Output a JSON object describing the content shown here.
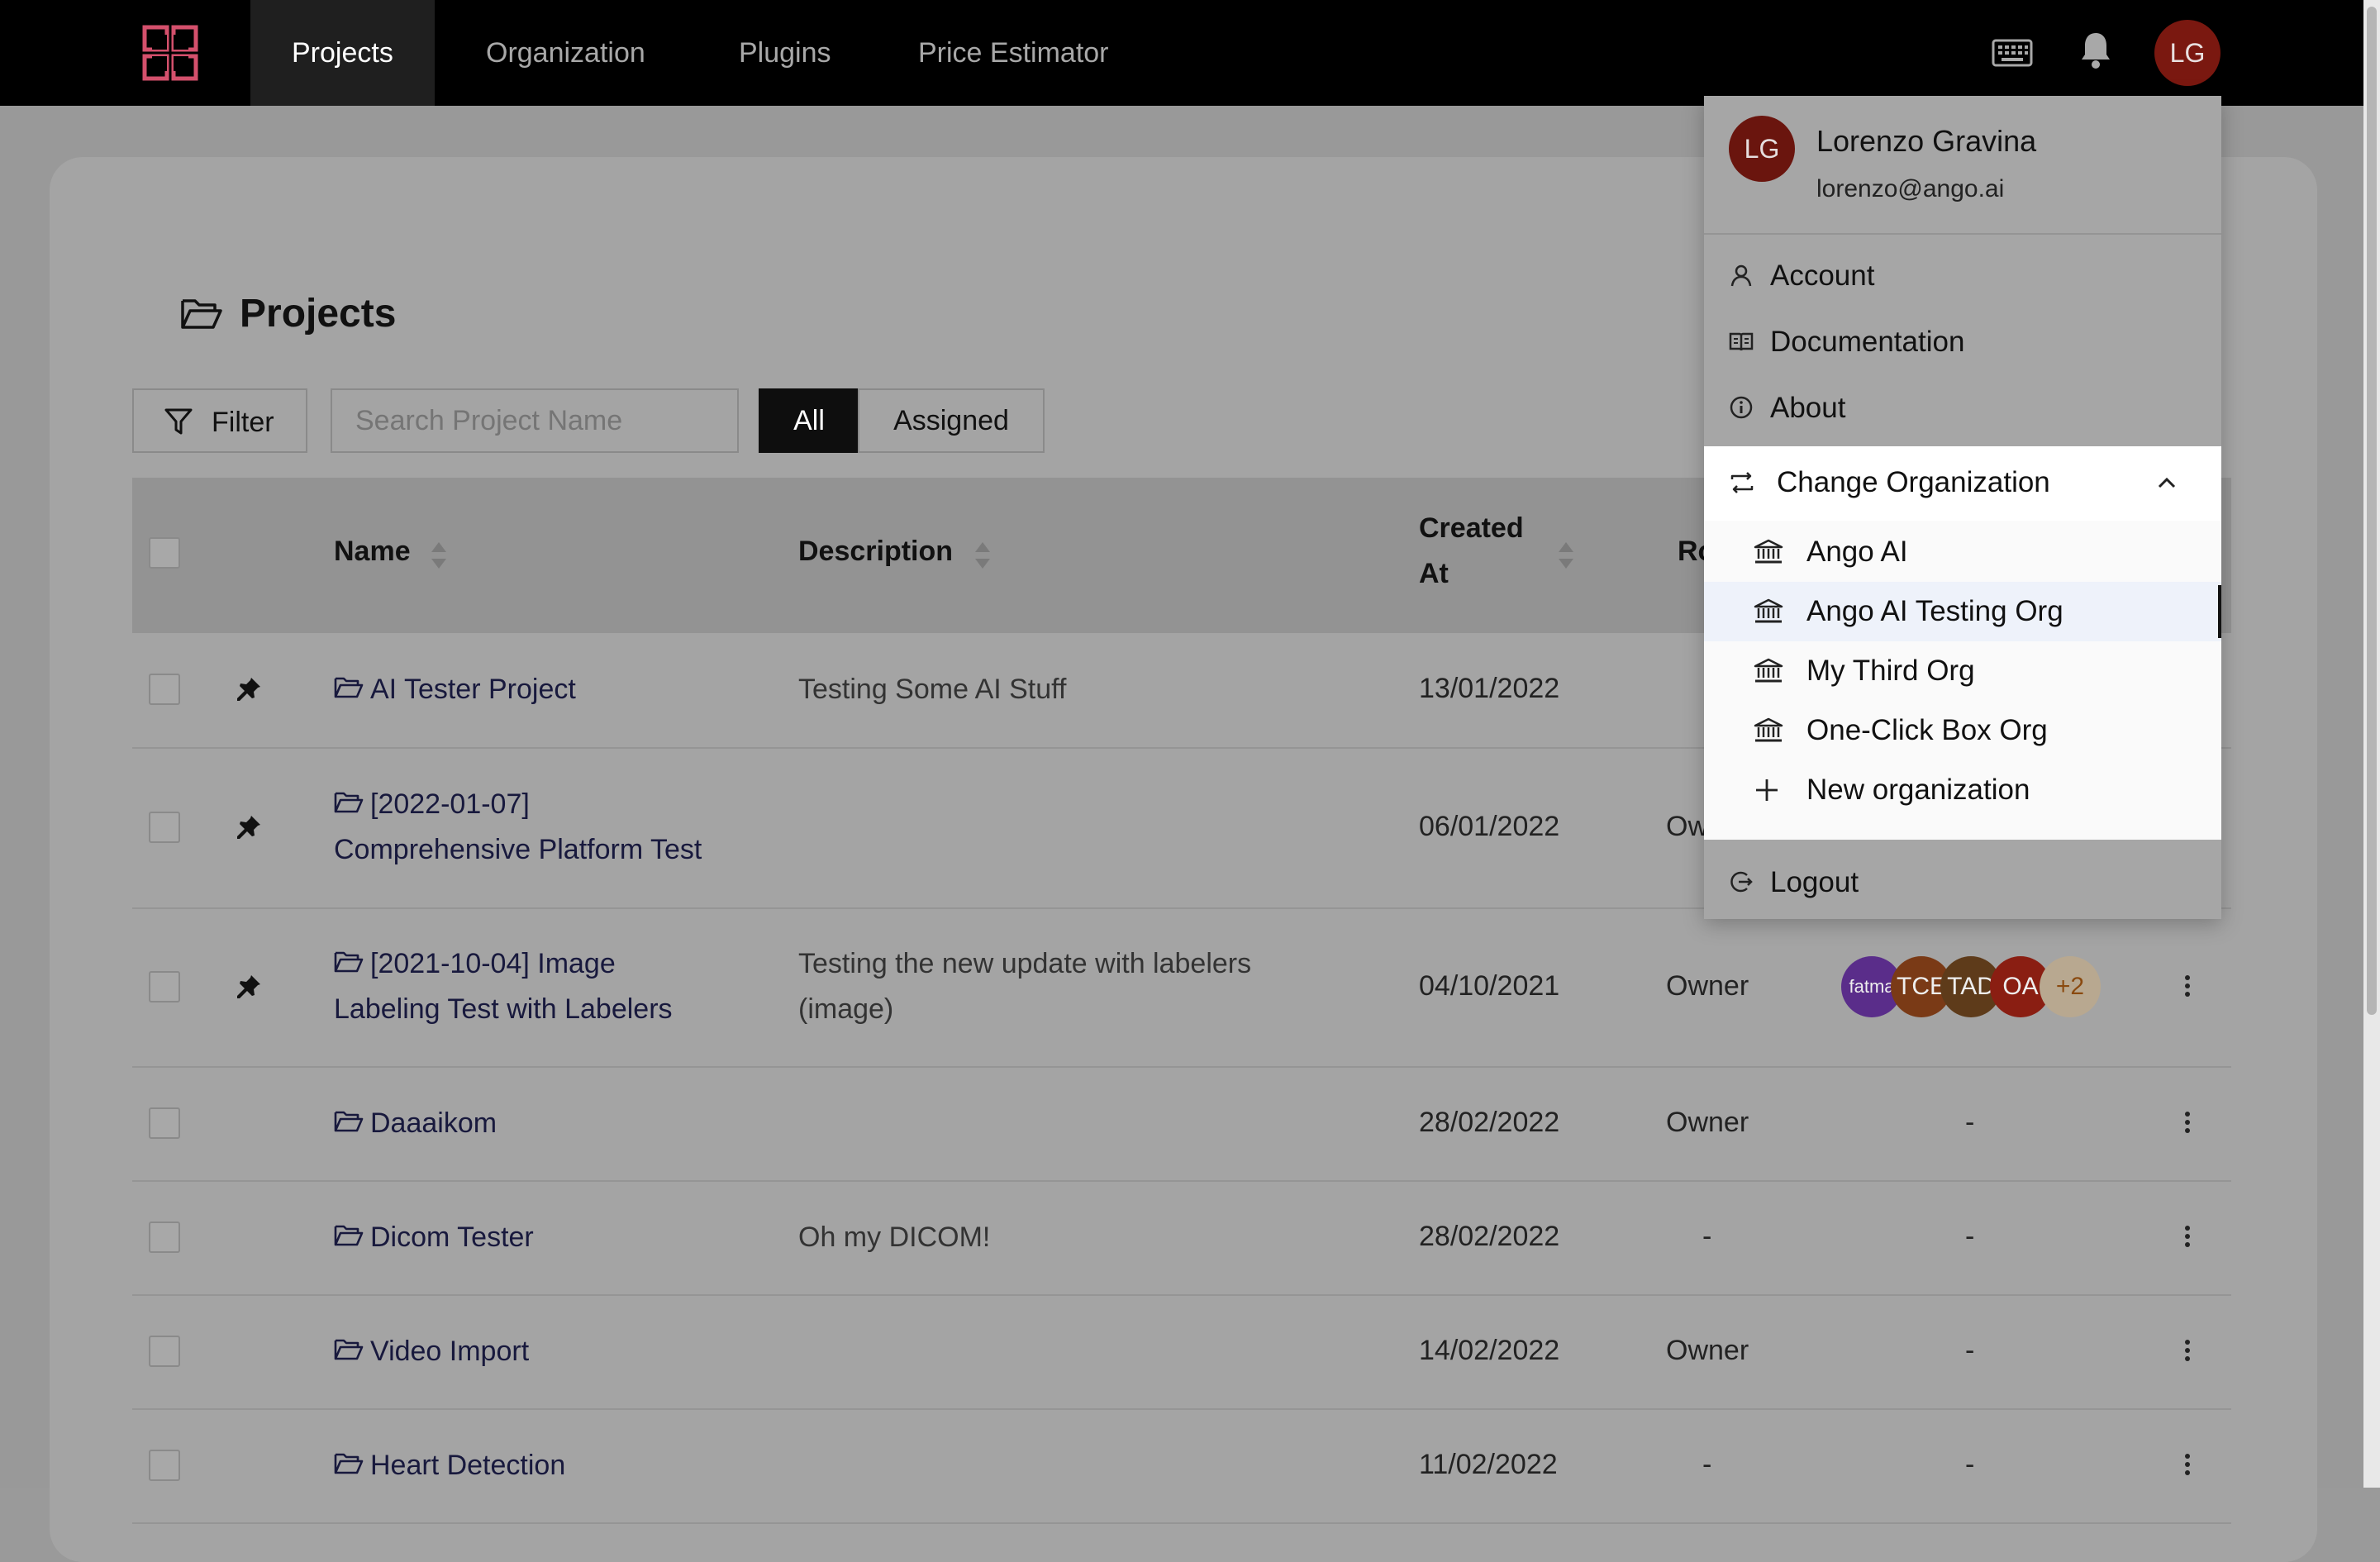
{
  "nav": {
    "items": [
      "Projects",
      "Organization",
      "Plugins",
      "Price Estimator"
    ],
    "avatar_initials": "LG"
  },
  "page": {
    "title": "Projects",
    "filter_label": "Filter",
    "search_placeholder": "Search Project Name",
    "segments": [
      "All",
      "Assigned"
    ]
  },
  "table": {
    "headers": {
      "name": "Name",
      "description": "Description",
      "created_line1": "Created",
      "created_line2": "At",
      "role": "Ro"
    },
    "rows": [
      {
        "name1": "AI Tester Project",
        "name2": "",
        "desc1": "Testing Some AI Stuff",
        "desc2": "",
        "created": "13/01/2022",
        "role": "",
        "members": "",
        "pinned": true
      },
      {
        "name1": "[2022-01-07]",
        "name2": "Comprehensive Platform Test",
        "desc1": "",
        "desc2": "",
        "created": "06/01/2022",
        "role": "Ow",
        "members": "",
        "pinned": true
      },
      {
        "name1": "[2021-10-04] Image",
        "name2": "Labeling Test with Labelers",
        "desc1": "Testing the new update with labelers",
        "desc2": "(image)",
        "created": "04/10/2021",
        "role": "Owner",
        "members": "",
        "pinned": true
      },
      {
        "name1": "Daaaikom",
        "name2": "",
        "desc1": "",
        "desc2": "",
        "created": "28/02/2022",
        "role": "Owner",
        "members": "-",
        "pinned": false
      },
      {
        "name1": "Dicom Tester",
        "name2": "",
        "desc1": "Oh my DICOM!",
        "desc2": "",
        "created": "28/02/2022",
        "role": "-",
        "members": "-",
        "pinned": false
      },
      {
        "name1": "Video Import",
        "name2": "",
        "desc1": "",
        "desc2": "",
        "created": "14/02/2022",
        "role": "Owner",
        "members": "-",
        "pinned": false
      },
      {
        "name1": "Heart Detection",
        "name2": "",
        "desc1": "",
        "desc2": "",
        "created": "11/02/2022",
        "role": "-",
        "members": "-",
        "pinned": false
      }
    ],
    "member_avatars": [
      {
        "label": "fatma",
        "color": "#5a2d8a"
      },
      {
        "label": "TCE",
        "color": "#7a3a16"
      },
      {
        "label": "TAD",
        "color": "#5e3b1a"
      },
      {
        "label": "OA",
        "color": "#8a1e12"
      },
      {
        "label": "+2",
        "color": "#b8a890",
        "text_color": "#8a4a10"
      }
    ]
  },
  "dropdown": {
    "avatar_initials": "LG",
    "name": "Lorenzo Gravina",
    "email": "lorenzo@ango.ai",
    "items": [
      "Account",
      "Documentation",
      "About"
    ],
    "change_org_label": "Change Organization",
    "orgs": [
      "Ango AI",
      "Ango AI Testing Org",
      "My Third Org",
      "One-Click Box Org"
    ],
    "highlighted_org": "Ango AI Testing Org",
    "new_org_label": "New organization",
    "logout_label": "Logout"
  }
}
